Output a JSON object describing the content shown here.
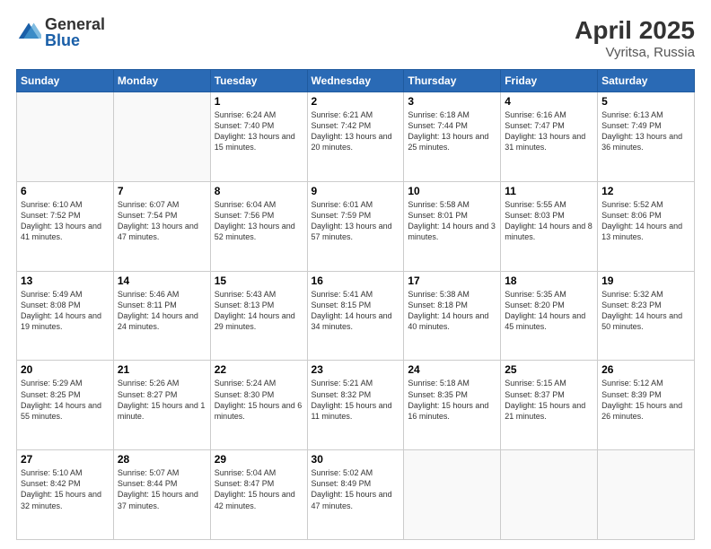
{
  "logo": {
    "general": "General",
    "blue": "Blue"
  },
  "title": "April 2025",
  "location": "Vyritsa, Russia",
  "days_of_week": [
    "Sunday",
    "Monday",
    "Tuesday",
    "Wednesday",
    "Thursday",
    "Friday",
    "Saturday"
  ],
  "weeks": [
    [
      {
        "day": "",
        "info": ""
      },
      {
        "day": "",
        "info": ""
      },
      {
        "day": "1",
        "info": "Sunrise: 6:24 AM\nSunset: 7:40 PM\nDaylight: 13 hours and 15 minutes."
      },
      {
        "day": "2",
        "info": "Sunrise: 6:21 AM\nSunset: 7:42 PM\nDaylight: 13 hours and 20 minutes."
      },
      {
        "day": "3",
        "info": "Sunrise: 6:18 AM\nSunset: 7:44 PM\nDaylight: 13 hours and 25 minutes."
      },
      {
        "day": "4",
        "info": "Sunrise: 6:16 AM\nSunset: 7:47 PM\nDaylight: 13 hours and 31 minutes."
      },
      {
        "day": "5",
        "info": "Sunrise: 6:13 AM\nSunset: 7:49 PM\nDaylight: 13 hours and 36 minutes."
      }
    ],
    [
      {
        "day": "6",
        "info": "Sunrise: 6:10 AM\nSunset: 7:52 PM\nDaylight: 13 hours and 41 minutes."
      },
      {
        "day": "7",
        "info": "Sunrise: 6:07 AM\nSunset: 7:54 PM\nDaylight: 13 hours and 47 minutes."
      },
      {
        "day": "8",
        "info": "Sunrise: 6:04 AM\nSunset: 7:56 PM\nDaylight: 13 hours and 52 minutes."
      },
      {
        "day": "9",
        "info": "Sunrise: 6:01 AM\nSunset: 7:59 PM\nDaylight: 13 hours and 57 minutes."
      },
      {
        "day": "10",
        "info": "Sunrise: 5:58 AM\nSunset: 8:01 PM\nDaylight: 14 hours and 3 minutes."
      },
      {
        "day": "11",
        "info": "Sunrise: 5:55 AM\nSunset: 8:03 PM\nDaylight: 14 hours and 8 minutes."
      },
      {
        "day": "12",
        "info": "Sunrise: 5:52 AM\nSunset: 8:06 PM\nDaylight: 14 hours and 13 minutes."
      }
    ],
    [
      {
        "day": "13",
        "info": "Sunrise: 5:49 AM\nSunset: 8:08 PM\nDaylight: 14 hours and 19 minutes."
      },
      {
        "day": "14",
        "info": "Sunrise: 5:46 AM\nSunset: 8:11 PM\nDaylight: 14 hours and 24 minutes."
      },
      {
        "day": "15",
        "info": "Sunrise: 5:43 AM\nSunset: 8:13 PM\nDaylight: 14 hours and 29 minutes."
      },
      {
        "day": "16",
        "info": "Sunrise: 5:41 AM\nSunset: 8:15 PM\nDaylight: 14 hours and 34 minutes."
      },
      {
        "day": "17",
        "info": "Sunrise: 5:38 AM\nSunset: 8:18 PM\nDaylight: 14 hours and 40 minutes."
      },
      {
        "day": "18",
        "info": "Sunrise: 5:35 AM\nSunset: 8:20 PM\nDaylight: 14 hours and 45 minutes."
      },
      {
        "day": "19",
        "info": "Sunrise: 5:32 AM\nSunset: 8:23 PM\nDaylight: 14 hours and 50 minutes."
      }
    ],
    [
      {
        "day": "20",
        "info": "Sunrise: 5:29 AM\nSunset: 8:25 PM\nDaylight: 14 hours and 55 minutes."
      },
      {
        "day": "21",
        "info": "Sunrise: 5:26 AM\nSunset: 8:27 PM\nDaylight: 15 hours and 1 minute."
      },
      {
        "day": "22",
        "info": "Sunrise: 5:24 AM\nSunset: 8:30 PM\nDaylight: 15 hours and 6 minutes."
      },
      {
        "day": "23",
        "info": "Sunrise: 5:21 AM\nSunset: 8:32 PM\nDaylight: 15 hours and 11 minutes."
      },
      {
        "day": "24",
        "info": "Sunrise: 5:18 AM\nSunset: 8:35 PM\nDaylight: 15 hours and 16 minutes."
      },
      {
        "day": "25",
        "info": "Sunrise: 5:15 AM\nSunset: 8:37 PM\nDaylight: 15 hours and 21 minutes."
      },
      {
        "day": "26",
        "info": "Sunrise: 5:12 AM\nSunset: 8:39 PM\nDaylight: 15 hours and 26 minutes."
      }
    ],
    [
      {
        "day": "27",
        "info": "Sunrise: 5:10 AM\nSunset: 8:42 PM\nDaylight: 15 hours and 32 minutes."
      },
      {
        "day": "28",
        "info": "Sunrise: 5:07 AM\nSunset: 8:44 PM\nDaylight: 15 hours and 37 minutes."
      },
      {
        "day": "29",
        "info": "Sunrise: 5:04 AM\nSunset: 8:47 PM\nDaylight: 15 hours and 42 minutes."
      },
      {
        "day": "30",
        "info": "Sunrise: 5:02 AM\nSunset: 8:49 PM\nDaylight: 15 hours and 47 minutes."
      },
      {
        "day": "",
        "info": ""
      },
      {
        "day": "",
        "info": ""
      },
      {
        "day": "",
        "info": ""
      }
    ]
  ]
}
